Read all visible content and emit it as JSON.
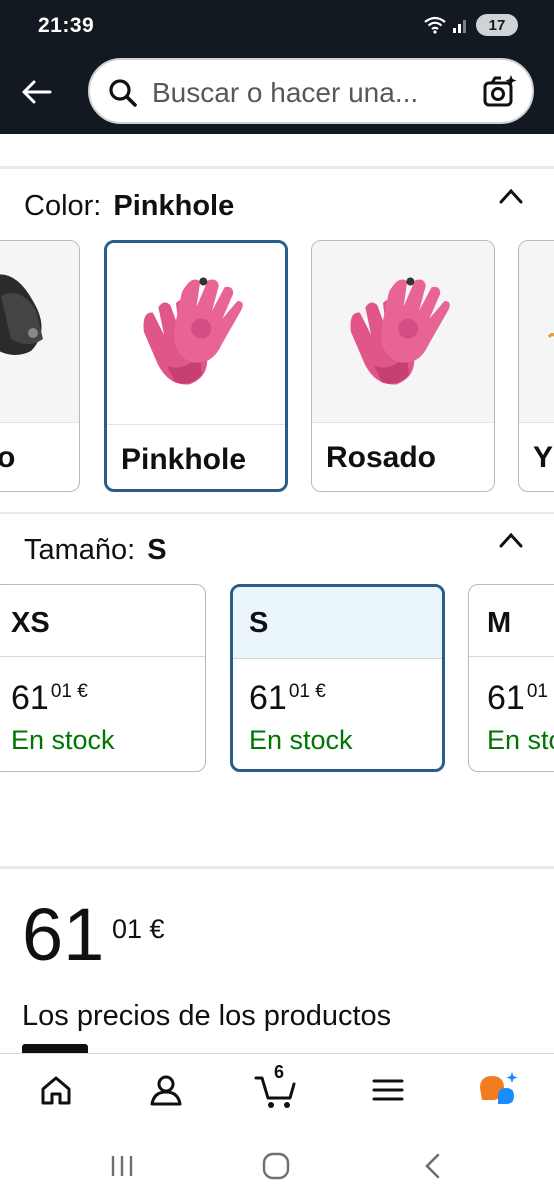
{
  "status_bar": {
    "time": "21:39",
    "battery": "17"
  },
  "header": {
    "search_placeholder": "Buscar o hacer una..."
  },
  "color_section": {
    "label": "Color:",
    "selected_value": "Pinkhole",
    "swatches": [
      {
        "label": "o",
        "image": "black-gloves",
        "selected": false
      },
      {
        "label": "Pinkhole",
        "image": "pink-gloves",
        "selected": true
      },
      {
        "label": "Rosado",
        "image": "pink-gloves",
        "selected": false
      },
      {
        "label": "Y",
        "image": "yellow-gloves",
        "selected": false
      }
    ]
  },
  "size_section": {
    "label": "Tamaño:",
    "selected_value": "S",
    "sizes": [
      {
        "name": "XS",
        "price_whole": "61",
        "price_fraction": "01 €",
        "availability": "En stock",
        "selected": false
      },
      {
        "name": "S",
        "price_whole": "61",
        "price_fraction": "01 €",
        "availability": "En stock",
        "selected": true
      },
      {
        "name": "M",
        "price_whole": "61",
        "price_fraction": "01",
        "availability": "En sto",
        "selected": false
      }
    ]
  },
  "price_block": {
    "whole": "61",
    "fraction": "01 €",
    "disclaimer": "Los precios de los productos"
  },
  "bottom_nav": {
    "items": [
      "home-icon",
      "account-icon",
      "cart-icon",
      "menu-icon",
      "rufus-icon"
    ],
    "cart_count": "6"
  },
  "colors": {
    "header_bg": "#131921",
    "selected_border": "#2a5e88",
    "in_stock": "#007600",
    "rufus_orange": "#f47c20",
    "rufus_blue": "#1a8cff"
  }
}
